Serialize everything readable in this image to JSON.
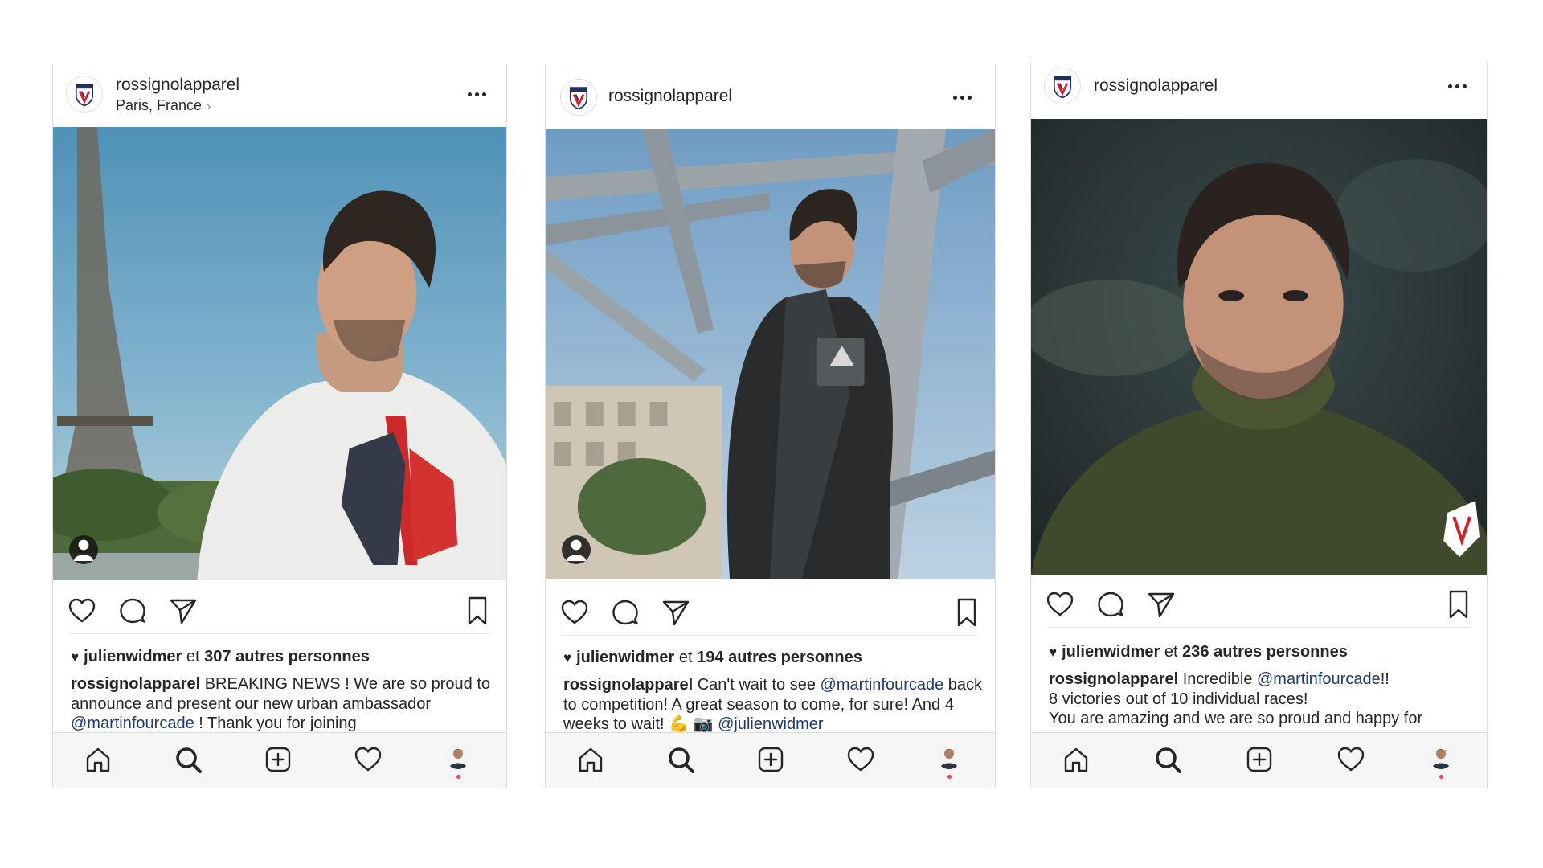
{
  "colors": {
    "accent_blue": "#1e3a6e",
    "text": "#262626",
    "notification_dot": "#ed4956",
    "rossignol_red": "#d9202a",
    "rossignol_navy": "#22305e"
  },
  "icons": {
    "header": [
      "rossignol-logo-icon",
      "more-options-icon"
    ],
    "actions": [
      "heart-icon",
      "comment-icon",
      "share-icon",
      "bookmark-icon"
    ],
    "tabbar": [
      "home-icon",
      "search-icon",
      "add-post-icon",
      "activity-icon",
      "profile-avatar-icon"
    ]
  },
  "posts": [
    {
      "username": "rossignolapparel",
      "location": "Paris, France",
      "liked_by_user": "julienwidmer",
      "liked_by_sep": "et",
      "liked_by_count": "307 autres personnes",
      "caption_user": "rossignolapparel",
      "caption_1": "BREAKING NEWS ! We are so proud to announce and present our new urban ambassador",
      "mention_1": "@martinfourcade",
      "caption_2": "! Thank you for joining"
    },
    {
      "username": "rossignolapparel",
      "liked_by_user": "julienwidmer",
      "liked_by_sep": "et",
      "liked_by_count": "194 autres personnes",
      "caption_user": "rossignolapparel",
      "caption_1": "Can't wait to see",
      "mention_1": "@martinfourcade",
      "caption_2": "back to competition! A great season to come, for sure! And 4 weeks to wait! 💪 📷",
      "mention_2": "@julienwidmer"
    },
    {
      "username": "rossignolapparel",
      "liked_by_user": "julienwidmer",
      "liked_by_sep": "et",
      "liked_by_count": "236 autres personnes",
      "caption_user": "rossignolapparel",
      "caption_1": "Incredible",
      "mention_1": "@martinfourcade",
      "caption_2": "!!",
      "caption_line2": "8 victories out of 10 individual races!",
      "caption_line3": "You are amazing and we are so proud and happy for"
    }
  ]
}
